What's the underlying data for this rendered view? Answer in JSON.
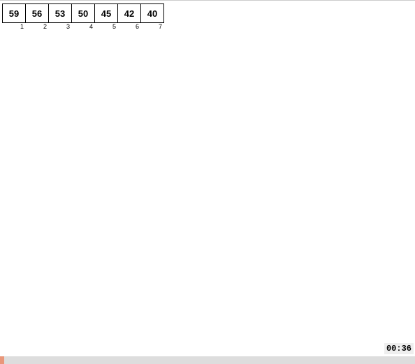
{
  "cells": [
    {
      "value": "59",
      "index": "1"
    },
    {
      "value": "56",
      "index": "2"
    },
    {
      "value": "53",
      "index": "3"
    },
    {
      "value": "50",
      "index": "4"
    },
    {
      "value": "45",
      "index": "5"
    },
    {
      "value": "42",
      "index": "6"
    },
    {
      "value": "40",
      "index": "7"
    }
  ],
  "timer": "00:36",
  "progress_percent": 1
}
